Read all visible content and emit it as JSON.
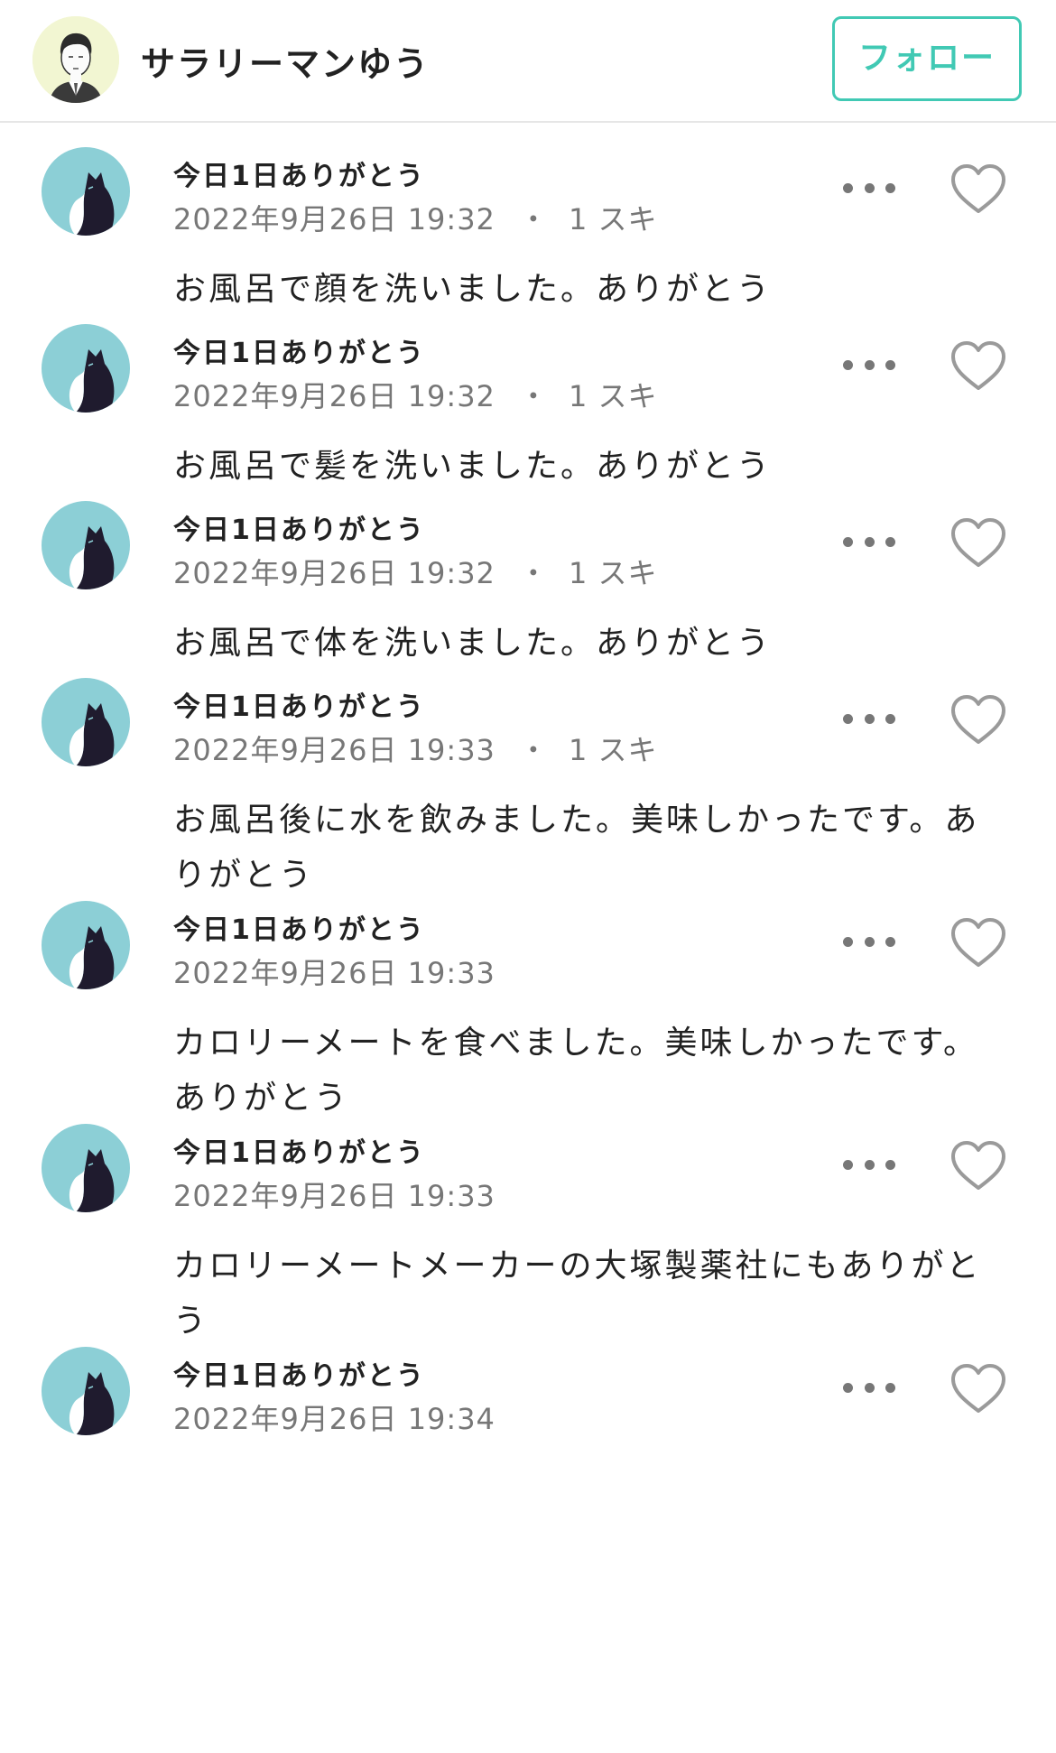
{
  "header": {
    "username": "サラリーマンゆう",
    "follow_label": "フォロー"
  },
  "colors": {
    "accent": "#41c9b4",
    "avatar_bg": "#8ccfd6",
    "meta_text": "#777777"
  },
  "posts": [
    {
      "title": "今日1日ありがとう",
      "date": "2022年9月26日 19:32",
      "separator": "・",
      "likes": "1 スキ",
      "body": "お風呂で顔を洗いました。ありがとう"
    },
    {
      "title": "今日1日ありがとう",
      "date": "2022年9月26日 19:32",
      "separator": "・",
      "likes": "1 スキ",
      "body": "お風呂で髪を洗いました。ありがとう"
    },
    {
      "title": "今日1日ありがとう",
      "date": "2022年9月26日 19:32",
      "separator": "・",
      "likes": "1 スキ",
      "body": "お風呂で体を洗いました。ありがとう"
    },
    {
      "title": "今日1日ありがとう",
      "date": "2022年9月26日 19:33",
      "separator": "・",
      "likes": "1 スキ",
      "body": "お風呂後に水を飲みました。美味しかったです。ありがとう"
    },
    {
      "title": "今日1日ありがとう",
      "date": "2022年9月26日 19:33",
      "separator": "",
      "likes": "",
      "body": "カロリーメートを食べました。美味しかったです。ありがとう"
    },
    {
      "title": "今日1日ありがとう",
      "date": "2022年9月26日 19:33",
      "separator": "",
      "likes": "",
      "body": "カロリーメートメーカーの大塚製薬社にもありがとう"
    },
    {
      "title": "今日1日ありがとう",
      "date": "2022年9月26日 19:34",
      "separator": "",
      "likes": "",
      "body": ""
    }
  ]
}
